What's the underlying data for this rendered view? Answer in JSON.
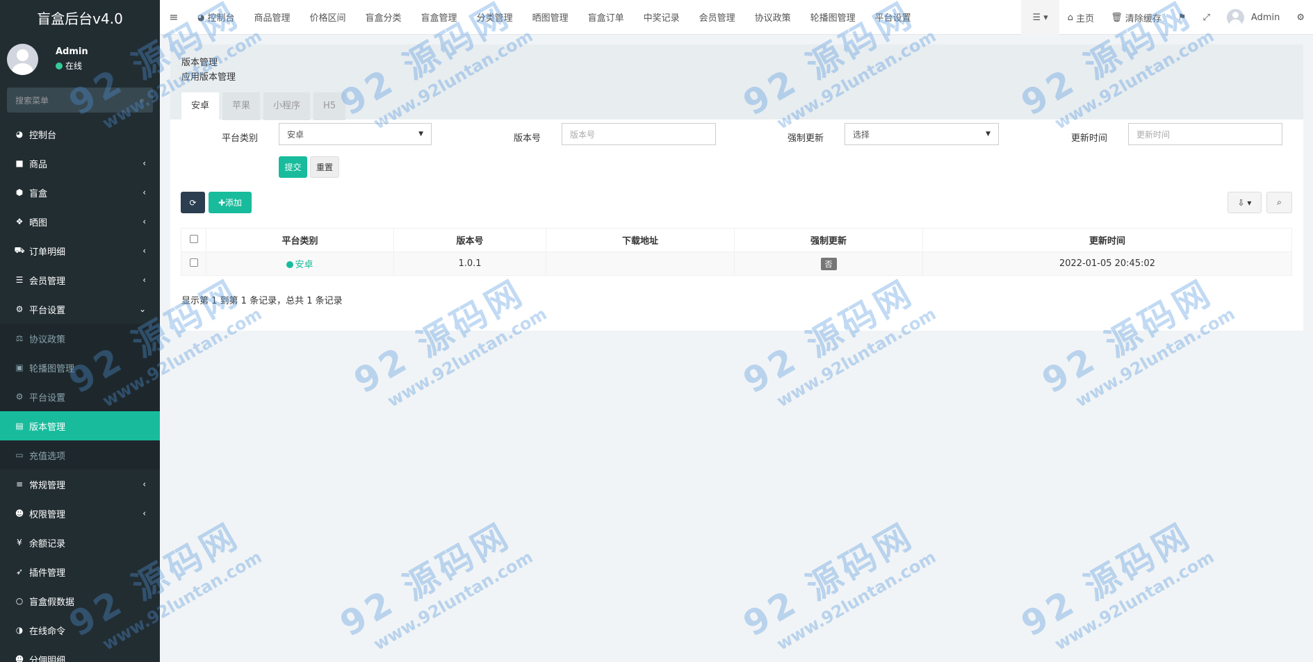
{
  "app": {
    "title": "盲盒后台v4.0"
  },
  "user": {
    "name": "Admin",
    "status": "在线"
  },
  "sidebar": {
    "search_placeholder": "搜索菜单",
    "items": [
      {
        "label": "控制台",
        "icon": "dashboard-icon",
        "glyph": "◕",
        "arrow": "",
        "kind": "top"
      },
      {
        "label": "商品",
        "icon": "shopping-bag-icon",
        "glyph": "■",
        "arrow": "‹",
        "kind": "top"
      },
      {
        "label": "盲盒",
        "icon": "cube-icon",
        "glyph": "⬢",
        "arrow": "‹",
        "kind": "top"
      },
      {
        "label": "晒图",
        "icon": "dropbox-icon",
        "glyph": "❖",
        "arrow": "‹",
        "kind": "top"
      },
      {
        "label": "订单明细",
        "icon": "cart-icon",
        "glyph": "⛟",
        "arrow": "‹",
        "kind": "top"
      },
      {
        "label": "会员管理",
        "icon": "list-icon",
        "glyph": "☰",
        "arrow": "‹",
        "kind": "top"
      },
      {
        "label": "平台设置",
        "icon": "gear-icon",
        "glyph": "⚙",
        "arrow": "⌄",
        "kind": "top"
      },
      {
        "label": "协议政策",
        "icon": "balance-scale-icon",
        "glyph": "⚖",
        "arrow": "",
        "kind": "sub"
      },
      {
        "label": "轮播图管理",
        "icon": "image-icon",
        "glyph": "▣",
        "arrow": "",
        "kind": "sub"
      },
      {
        "label": "平台设置",
        "icon": "gear-icon",
        "glyph": "⚙",
        "arrow": "",
        "kind": "sub"
      },
      {
        "label": "版本管理",
        "icon": "list-alt-icon",
        "glyph": "▤",
        "arrow": "",
        "kind": "active-sub"
      },
      {
        "label": "充值选项",
        "icon": "keyboard-icon",
        "glyph": "▭",
        "arrow": "",
        "kind": "sub"
      },
      {
        "label": "常规管理",
        "icon": "database-icon",
        "glyph": "≡",
        "arrow": "‹",
        "kind": "top"
      },
      {
        "label": "权限管理",
        "icon": "group-icon",
        "glyph": "☻",
        "arrow": "‹",
        "kind": "top"
      },
      {
        "label": "余额记录",
        "icon": "yen-icon",
        "glyph": "¥",
        "arrow": "",
        "kind": "top"
      },
      {
        "label": "插件管理",
        "icon": "rocket-icon",
        "glyph": "➶",
        "arrow": "",
        "kind": "top"
      },
      {
        "label": "盲盒假数据",
        "icon": "circle-o-icon",
        "glyph": "○",
        "arrow": "",
        "kind": "top"
      },
      {
        "label": "在线命令",
        "icon": "adjust-icon",
        "glyph": "◑",
        "arrow": "",
        "kind": "top"
      },
      {
        "label": "分佣明细",
        "icon": "users-icon",
        "glyph": "☻",
        "arrow": "",
        "kind": "top"
      }
    ]
  },
  "navbar": {
    "tabs": [
      {
        "label": "控制台",
        "icon": "dashboard-icon",
        "glyph": "◕"
      },
      {
        "label": "商品管理"
      },
      {
        "label": "价格区间"
      },
      {
        "label": "盲盒分类"
      },
      {
        "label": "盲盒管理"
      },
      {
        "label": "分类管理"
      },
      {
        "label": "晒图管理"
      },
      {
        "label": "盲盒订单"
      },
      {
        "label": "中奖记录"
      },
      {
        "label": "会员管理"
      },
      {
        "label": "协议政策"
      },
      {
        "label": "轮播图管理"
      },
      {
        "label": "平台设置"
      }
    ],
    "home_label": "主页",
    "clear_cache_label": "清除缓存",
    "admin_label": "Admin"
  },
  "page": {
    "title": "版本管理",
    "subtitle": "应用版本管理",
    "tabs": [
      "安卓",
      "苹果",
      "小程序",
      "H5"
    ]
  },
  "filter": {
    "platform_label": "平台类别",
    "platform_value": "安卓",
    "version_label": "版本号",
    "version_placeholder": "版本号",
    "force_label": "强制更新",
    "force_value": "选择",
    "time_label": "更新时间",
    "time_placeholder": "更新时间",
    "submit_label": "提交",
    "reset_label": "重置"
  },
  "toolbar": {
    "add_label": "添加"
  },
  "table": {
    "headers": [
      "平台类别",
      "版本号",
      "下载地址",
      "强制更新",
      "更新时间"
    ],
    "rows": [
      {
        "platform": "安卓",
        "version": "1.0.1",
        "url": "",
        "force": "否",
        "time": "2022-01-05 20:45:02"
      }
    ]
  },
  "pagination": {
    "info": "显示第 1 到第 1 条记录，总共 1 条记录"
  },
  "colors": {
    "accent": "#18bc9c",
    "sidebar_bg": "#222d32",
    "dark_button": "#2c3e50"
  },
  "watermark": {
    "logo_text": "92 源码网",
    "site": "www.92luntan.com"
  }
}
